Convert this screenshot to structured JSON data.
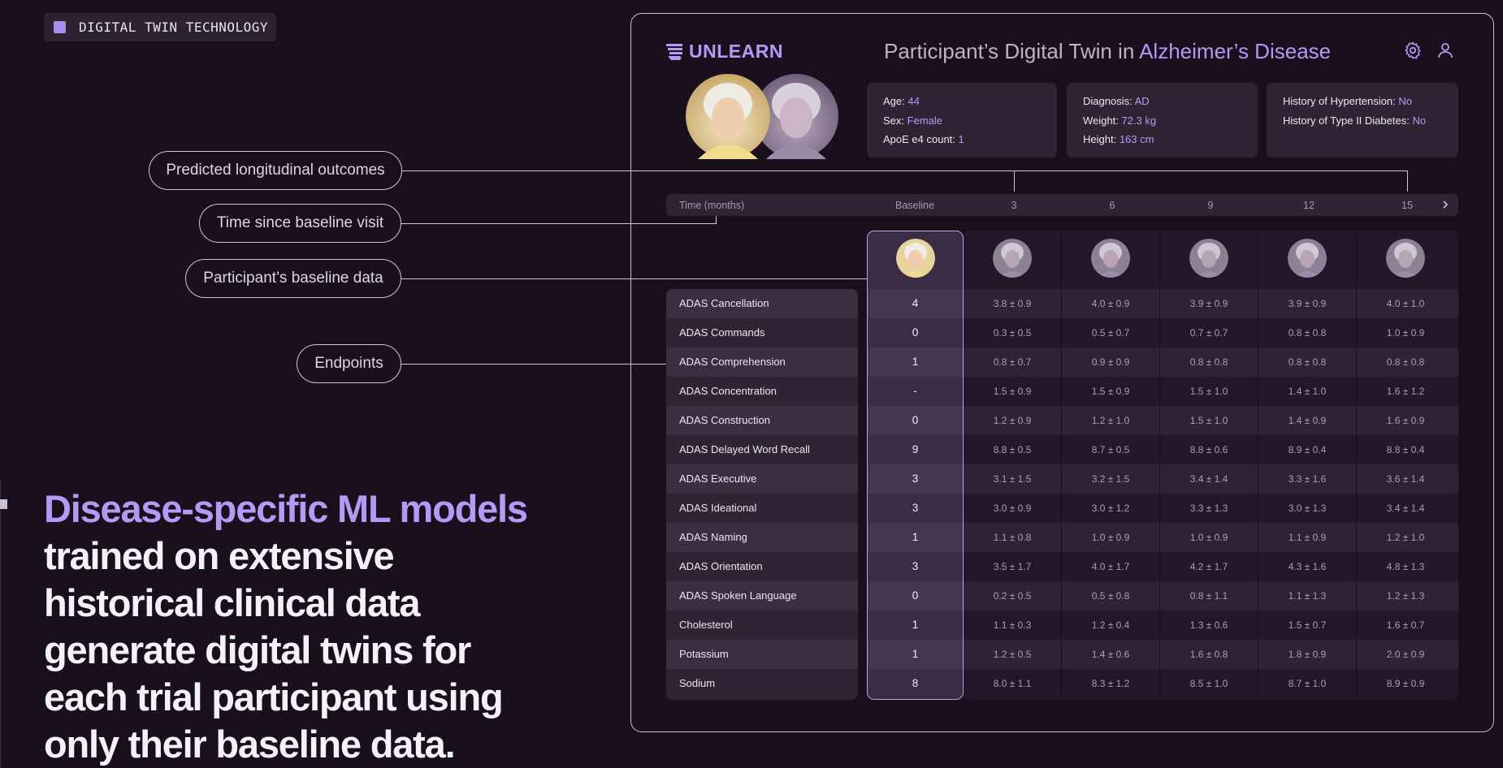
{
  "badge": {
    "text": "DIGITAL TWIN TECHNOLOGY"
  },
  "headline": {
    "accent": "Disease-specific ML models",
    "line1": "trained on extensive",
    "line2": "historical clinical data",
    "line3": "generate digital twins for",
    "line4": "each trial participant using",
    "line5": "only their baseline data."
  },
  "callouts": {
    "predicted": "Predicted longitudinal outcomes",
    "time": "Time since baseline visit",
    "baseline": "Participant’s baseline data",
    "endpoints": "Endpoints"
  },
  "app": {
    "logo": "UNLEARN",
    "title_prefix": "Participant’s Digital Twin in ",
    "title_highlight": "Alzheimer’s Disease",
    "icons": {
      "settings": "gear-icon",
      "user": "user-icon",
      "next": "chevron-right-icon"
    }
  },
  "cards": {
    "c1": {
      "age_l": "Age: ",
      "age_v": "44",
      "sex_l": "Sex: ",
      "sex_v": "Female",
      "apoe_l": "ApoE e4 count: ",
      "apoe_v": "1"
    },
    "c2": {
      "diag_l": "Diagnosis: ",
      "diag_v": "AD",
      "weight_l": "Weight: ",
      "weight_v": "72.3 kg",
      "height_l": "Height: ",
      "height_v": "163 cm"
    },
    "c3": {
      "hyp_l": "History of Hypertension: ",
      "hyp_v": "No",
      "diab_l": "History of Type II Diabetes: ",
      "diab_v": "No"
    }
  },
  "time": {
    "label": "Time (months)",
    "cols": [
      "Baseline",
      "3",
      "6",
      "9",
      "12",
      "15"
    ]
  },
  "rows": [
    {
      "name": "ADAS Cancellation",
      "baseline": "4",
      "vals": [
        "3.8 ± 0.9",
        "4.0 ± 0.9",
        "3.9 ± 0.9",
        "3.9 ± 0.9",
        "4.0 ± 1.0"
      ]
    },
    {
      "name": "ADAS Commands",
      "baseline": "0",
      "vals": [
        "0.3 ± 0.5",
        "0.5 ± 0.7",
        "0.7 ± 0.7",
        "0.8 ± 0.8",
        "1.0 ± 0.9"
      ]
    },
    {
      "name": "ADAS Comprehension",
      "baseline": "1",
      "vals": [
        "0.8 ± 0.7",
        "0.9 ± 0.9",
        "0.8 ± 0.8",
        "0.8 ± 0.8",
        "0.8 ± 0.8"
      ]
    },
    {
      "name": "ADAS Concentration",
      "baseline": "-",
      "vals": [
        "1.5 ± 0.9",
        "1.5 ± 0.9",
        "1.5 ± 1.0",
        "1.4 ± 1.0",
        "1.6 ± 1.2"
      ]
    },
    {
      "name": "ADAS Construction",
      "baseline": "0",
      "vals": [
        "1.2 ± 0.9",
        "1.2 ± 1.0",
        "1.5 ± 1.0",
        "1.4 ± 0.9",
        "1.6 ± 0.9"
      ]
    },
    {
      "name": "ADAS Delayed Word Recall",
      "baseline": "9",
      "vals": [
        "8.8 ± 0.5",
        "8.7 ± 0.5",
        "8.8 ± 0.6",
        "8.9 ± 0.4",
        "8.8 ± 0.4"
      ]
    },
    {
      "name": "ADAS Executive",
      "baseline": "3",
      "vals": [
        "3.1 ± 1.5",
        "3.2 ± 1.5",
        "3.4 ± 1.4",
        "3.3 ± 1.6",
        "3.6 ± 1.4"
      ]
    },
    {
      "name": "ADAS Ideational",
      "baseline": "3",
      "vals": [
        "3.0 ± 0.9",
        "3.0 ± 1.2",
        "3.3 ± 1.3",
        "3.0 ± 1.3",
        "3.4 ± 1.4"
      ]
    },
    {
      "name": "ADAS Naming",
      "baseline": "1",
      "vals": [
        "1.1 ± 0.8",
        "1.0 ± 0.9",
        "1.0 ± 0.9",
        "1.1 ± 0.9",
        "1.2 ± 1.0"
      ]
    },
    {
      "name": "ADAS Orientation",
      "baseline": "3",
      "vals": [
        "3.5 ± 1.7",
        "4.0 ± 1.7",
        "4.2 ± 1.7",
        "4.3 ± 1.6",
        "4.8 ± 1.3"
      ]
    },
    {
      "name": "ADAS Spoken Language",
      "baseline": "0",
      "vals": [
        "0.2 ± 0.5",
        "0.5 ± 0.8",
        "0.8 ± 1.1",
        "1.1 ± 1.3",
        "1.2 ± 1.3"
      ]
    },
    {
      "name": "Cholesterol",
      "baseline": "1",
      "vals": [
        "1.1 ± 0.3",
        "1.2 ± 0.4",
        "1.3 ± 0.6",
        "1.5 ± 0.7",
        "1.6 ± 0.7"
      ]
    },
    {
      "name": "Potassium",
      "baseline": "1",
      "vals": [
        "1.2 ± 0.5",
        "1.4 ± 0.6",
        "1.6 ± 0.8",
        "1.8 ± 0.9",
        "2.0 ± 0.9"
      ]
    },
    {
      "name": "Sodium",
      "baseline": "8",
      "vals": [
        "8.0 ± 1.1",
        "8.3 ± 1.2",
        "8.5 ± 1.0",
        "8.7 ± 1.0",
        "8.9 ± 0.9"
      ]
    }
  ]
}
